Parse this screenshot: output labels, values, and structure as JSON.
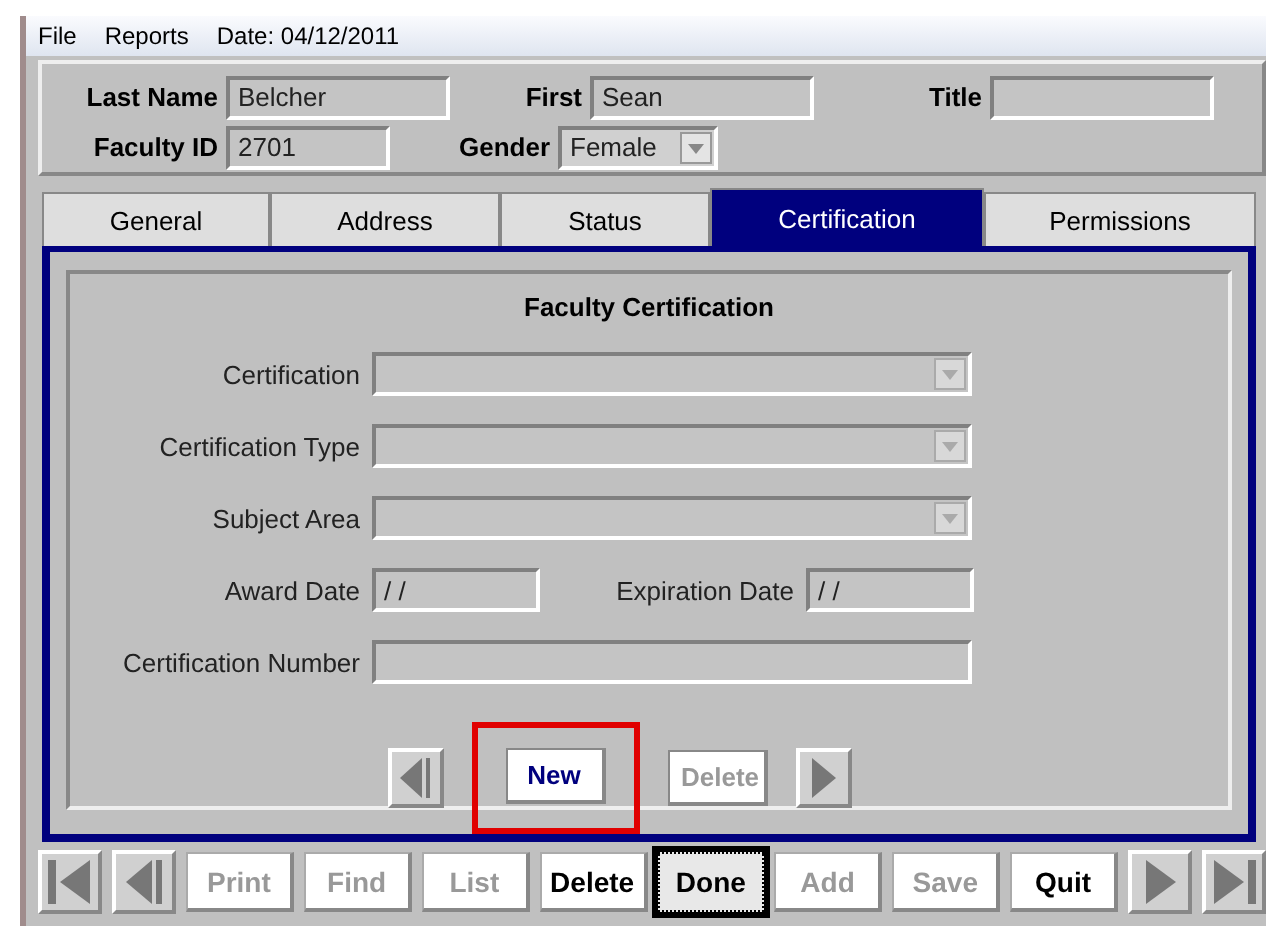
{
  "menu": [
    "File",
    "Reports"
  ],
  "date": "Date: 04/12/2011",
  "header": {
    "last_name": {
      "label": "Last Name",
      "value": "Belcher"
    },
    "first": {
      "label": "First",
      "value": "Sean"
    },
    "title": {
      "label": "Title"
    },
    "faculty_id": {
      "label": "Faculty ID",
      "value": "2701"
    },
    "gender": {
      "label": "Gender",
      "value": "Female"
    }
  },
  "tabs": [
    {
      "label": "General",
      "selected": false
    },
    {
      "label": "Address",
      "selected": false
    },
    {
      "label": "Status",
      "selected": false
    },
    {
      "label": "Certification",
      "selected": true
    },
    {
      "label": "Permissions",
      "selected": false
    }
  ],
  "panel_title": "Faculty Certification",
  "fields": [
    {
      "kind": "dropdown",
      "label": "Certification"
    },
    {
      "kind": "dropdown",
      "label": "Certification Type"
    },
    {
      "kind": "dropdown",
      "label": "Subject Area"
    },
    {
      "kind": "dates",
      "label": "Award Date",
      "value": " / /",
      "label2": "Expiration Date",
      "value2": " / /"
    },
    {
      "kind": "text",
      "label": "Certification Number"
    }
  ],
  "record_buttons": [
    {
      "label": "New",
      "disabled": false,
      "highlighted": true
    },
    {
      "label": "Delete",
      "disabled": true,
      "highlighted": false
    }
  ],
  "toolbar": [
    {
      "label": "Print",
      "disabled": true,
      "focused": false
    },
    {
      "label": "Find",
      "disabled": true,
      "focused": false
    },
    {
      "label": "List",
      "disabled": true,
      "focused": false
    },
    {
      "label": "Delete",
      "disabled": false,
      "focused": false
    },
    {
      "label": "Done",
      "disabled": false,
      "focused": true
    },
    {
      "label": "Add",
      "disabled": true,
      "focused": false
    },
    {
      "label": "Save",
      "disabled": true,
      "focused": false
    },
    {
      "label": "Quit",
      "disabled": false,
      "focused": false
    }
  ]
}
